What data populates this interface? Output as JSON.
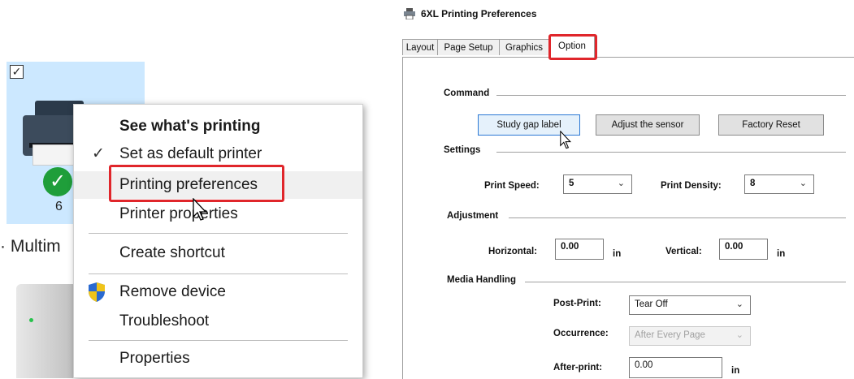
{
  "left": {
    "tile_label": "6",
    "partial_device_name": "Multim",
    "context_menu": {
      "items": [
        {
          "label": "See what's printing",
          "bold": true
        },
        {
          "label": "Set as default printer",
          "checked": true
        },
        {
          "label": "Printing preferences",
          "highlighted": true
        },
        {
          "label": "Printer properties"
        },
        {
          "label": "Create shortcut"
        },
        {
          "label": "Remove device",
          "icon": "shield-icon"
        },
        {
          "label": "Troubleshoot"
        },
        {
          "label": "Properties"
        }
      ]
    }
  },
  "dialog": {
    "title": "6XL Printing Preferences",
    "tabs": [
      "Layout",
      "Page Setup",
      "Graphics",
      "Option"
    ],
    "active_tab": "Option",
    "command": {
      "group_label": "Command",
      "buttons": [
        "Study gap label",
        "Adjust the sensor",
        "Factory Reset"
      ]
    },
    "settings": {
      "group_label": "Settings",
      "print_speed_label": "Print Speed:",
      "print_speed_value": "5",
      "print_density_label": "Print Density:",
      "print_density_value": "8"
    },
    "adjustment": {
      "group_label": "Adjustment",
      "horizontal_label": "Horizontal:",
      "horizontal_value": "0.00",
      "horizontal_unit": "in",
      "vertical_label": "Vertical:",
      "vertical_value": "0.00",
      "vertical_unit": "in"
    },
    "media_handling": {
      "group_label": "Media Handling",
      "post_print_label": "Post-Print:",
      "post_print_value": "Tear Off",
      "occurrence_label": "Occurrence:",
      "occurrence_value": "After Every Page",
      "after_print_label": "After-print:",
      "after_print_value": "0.00",
      "after_print_unit": "in"
    }
  },
  "colors": {
    "highlight": "#e0262b",
    "tile_selected": "#cce8ff",
    "check_badge": "#1f9e3a"
  }
}
